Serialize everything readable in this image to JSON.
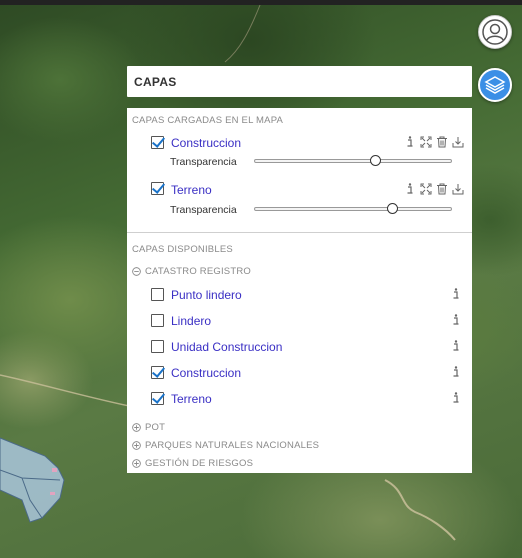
{
  "panel": {
    "title": "CAPAS",
    "loaded_section_title": "CAPAS CARGADAS EN EL MAPA",
    "available_section_title": "CAPAS DISPONIBLES",
    "transparency_label": "Transparencia"
  },
  "loaded_layers": [
    {
      "name": "Construccion",
      "checked": true,
      "transparency": 0.61
    },
    {
      "name": "Terreno",
      "checked": true,
      "transparency": 0.7
    }
  ],
  "groups": {
    "catastro": {
      "label": "CATASTRO REGISTRO",
      "expanded": true,
      "layers": [
        {
          "name": "Punto lindero",
          "checked": false
        },
        {
          "name": "Lindero",
          "checked": false
        },
        {
          "name": "Unidad Construccion",
          "checked": false
        },
        {
          "name": "Construccion",
          "checked": true
        },
        {
          "name": "Terreno",
          "checked": true
        }
      ]
    },
    "collapsed": [
      {
        "label": "POT"
      },
      {
        "label": "PARQUES NATURALES NACIONALES"
      },
      {
        "label": "GESTIÓN DE RIESGOS"
      }
    ]
  },
  "colors": {
    "accent": "#3b8fe6",
    "layer_link": "#3a2fc4",
    "check": "#1a73c9",
    "parcel_fill": "#a9c6dc"
  },
  "icons": {
    "user_button": "user-icon",
    "layers_button": "layers-icon"
  }
}
